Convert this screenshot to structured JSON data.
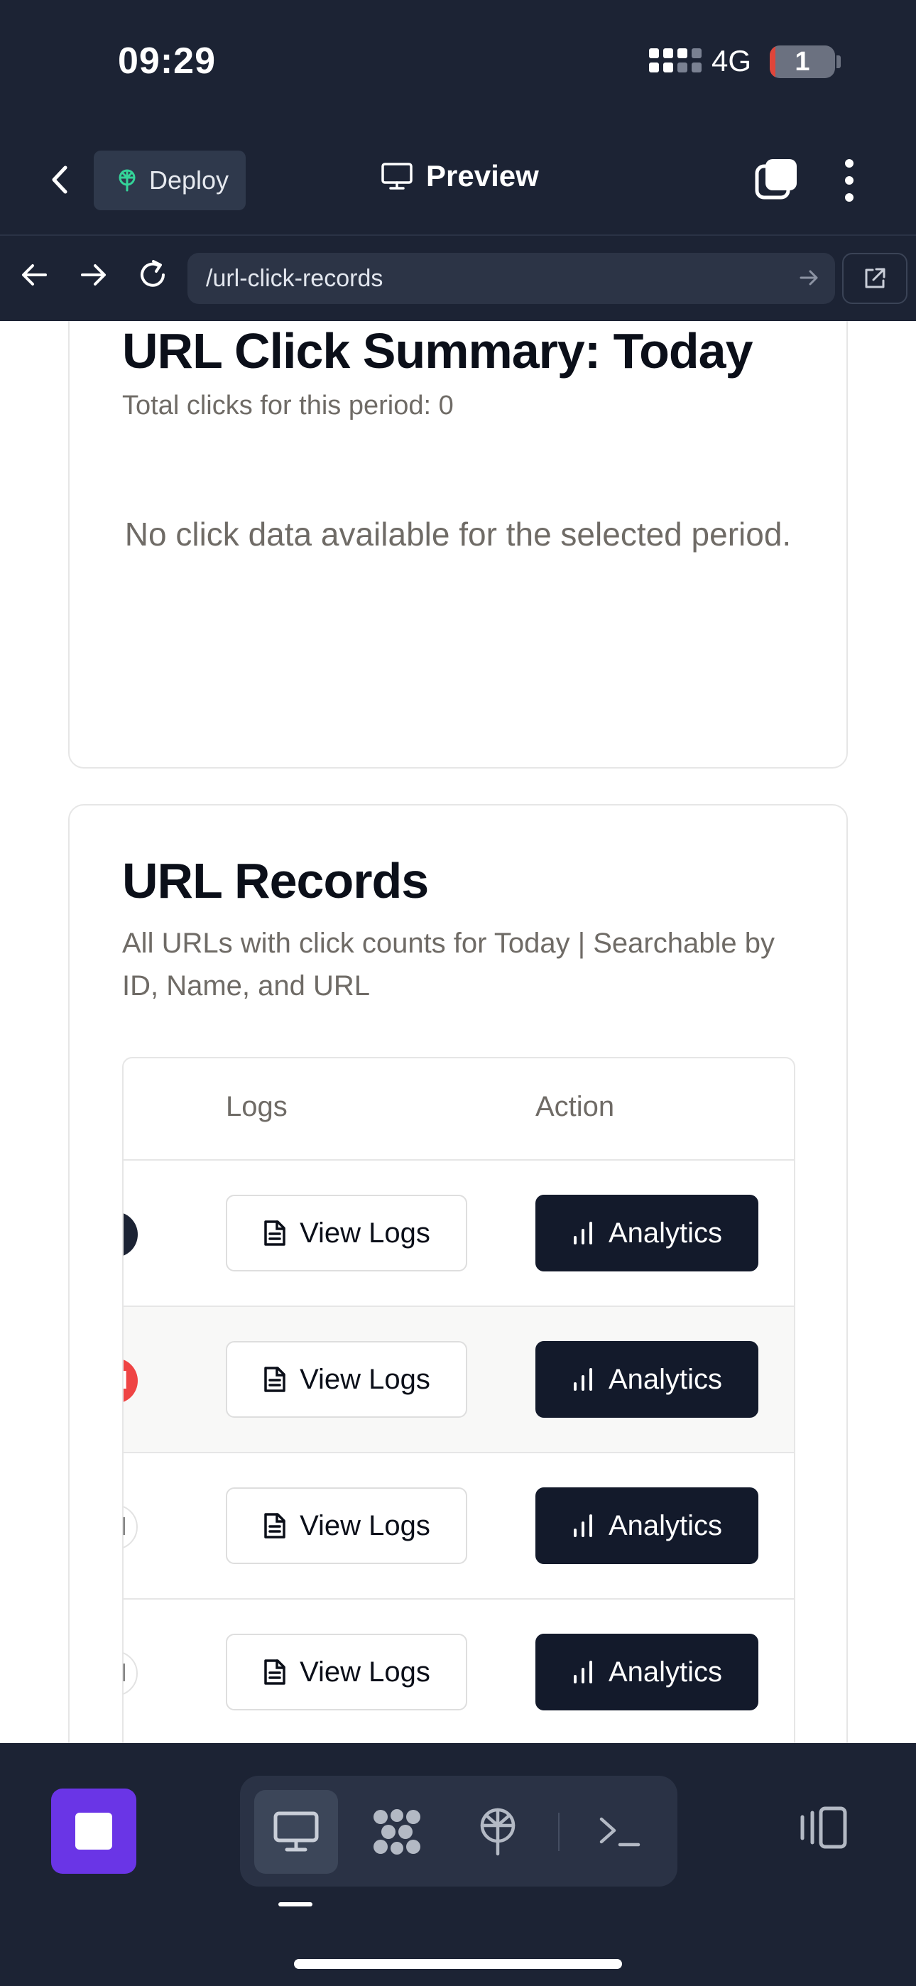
{
  "status_bar": {
    "time": "09:29",
    "network": "4G",
    "battery_level": "1"
  },
  "app_header": {
    "deploy_label": "Deploy",
    "preview_label": "Preview"
  },
  "browser": {
    "url": "/url-click-records"
  },
  "summary_card": {
    "title": "URL Click Summary: Today",
    "total_text": "Total clicks for this period: 0",
    "empty_message": "No click data available for the selected period."
  },
  "records_card": {
    "title": "URL Records",
    "subtitle": "All URLs with click counts for Today | Searchable by ID, Name, and URL",
    "columns": [
      "Logs",
      "Action"
    ],
    "rows": [
      {
        "badge_text": "",
        "badge_style": "dark",
        "logs_label": "View Logs",
        "action_label": "Analytics"
      },
      {
        "badge_text": "d",
        "badge_style": "red",
        "logs_label": "View Logs",
        "action_label": "Analytics"
      },
      {
        "badge_text": "l",
        "badge_style": "outline",
        "logs_label": "View Logs",
        "action_label": "Analytics"
      },
      {
        "badge_text": "l",
        "badge_style": "outline",
        "logs_label": "View Logs",
        "action_label": "Analytics"
      }
    ]
  },
  "colors": {
    "accent": "#6a35e6",
    "dark_ui": "#1c2334",
    "button_dark": "#131a2b",
    "badge_red": "#ef4444"
  }
}
